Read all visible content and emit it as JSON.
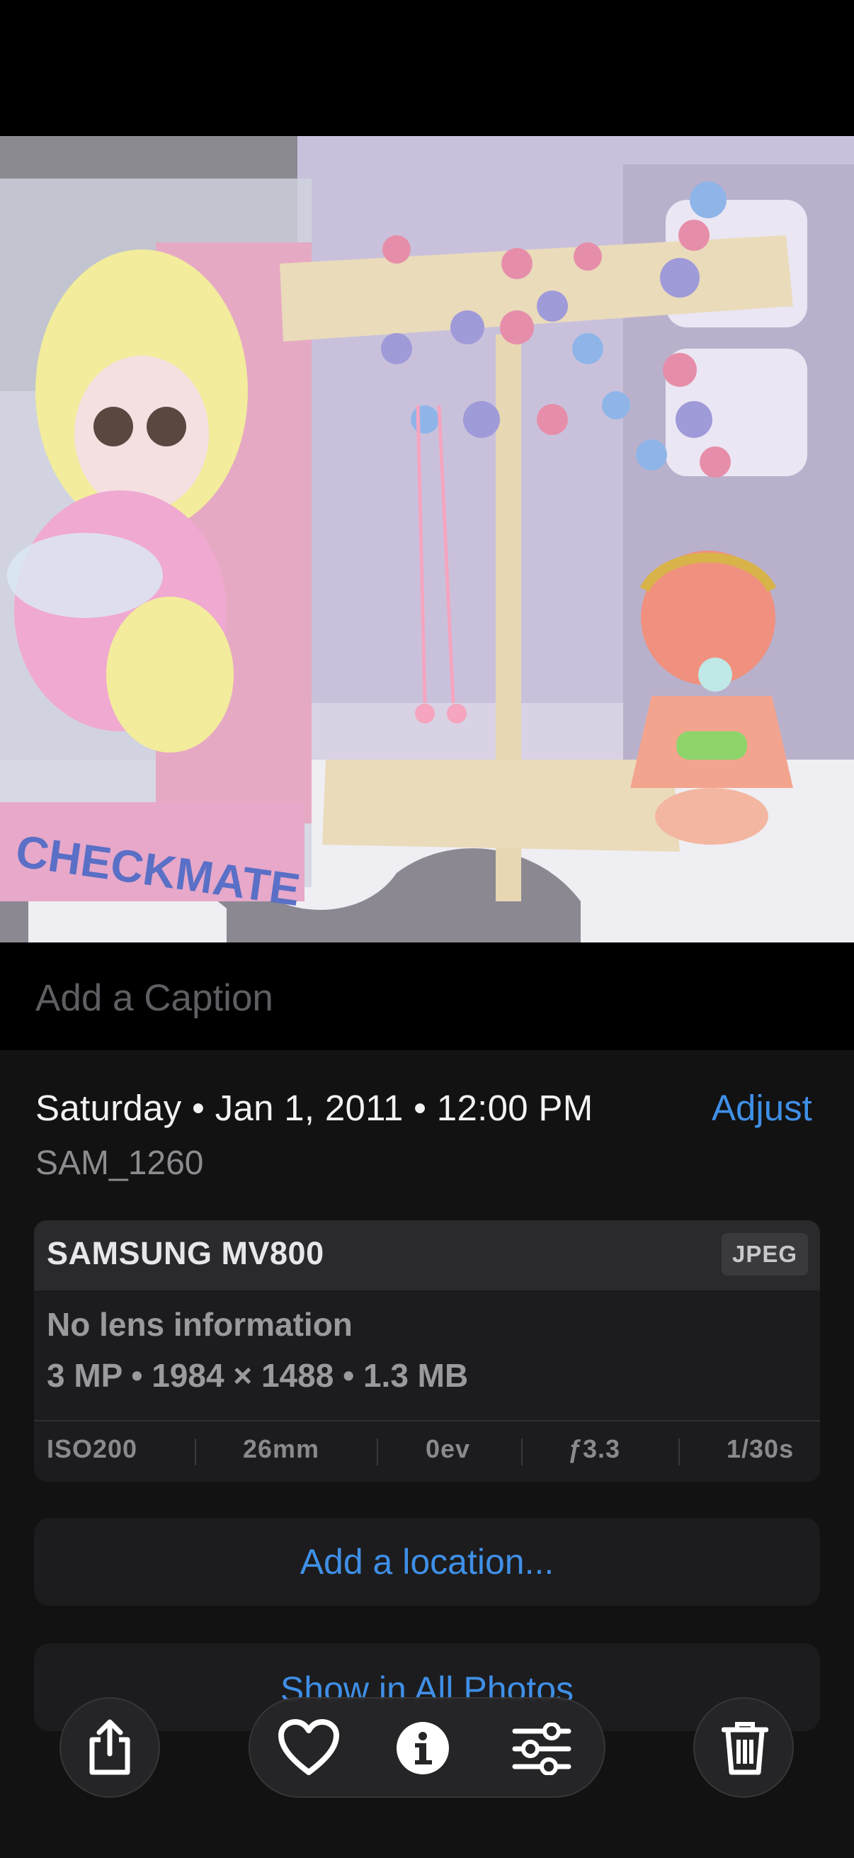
{
  "caption": {
    "placeholder": "Add a Caption"
  },
  "header": {
    "datetime": "Saturday • Jan 1, 2011 • 12:00 PM",
    "adjust_label": "Adjust",
    "filename": "SAM_1260"
  },
  "camera": {
    "model": "SAMSUNG MV800",
    "format": "JPEG",
    "lens": "No lens information",
    "details": "3 MP • 1984 × 1488 • 1.3 MB",
    "exif": [
      "ISO200",
      "26mm",
      "0ev",
      "ƒ3.3",
      "1/30s"
    ]
  },
  "actions": {
    "location_label": "Add a location...",
    "all_photos_label": "Show in All Photos"
  },
  "toolbar": {
    "icons": [
      "share-icon",
      "heart-icon",
      "info-icon",
      "sliders-icon",
      "trash-icon"
    ]
  },
  "colors": {
    "accent": "#3f8fe6",
    "background": "#121212",
    "card": "#1c1c1e"
  }
}
